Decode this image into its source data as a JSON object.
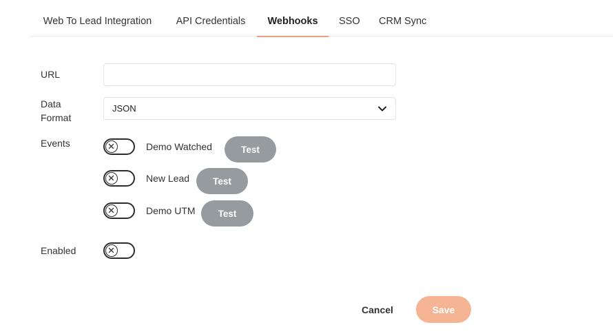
{
  "tabs": [
    {
      "label": "Web To Lead Integration",
      "active": false
    },
    {
      "label": "API Credentials",
      "active": false
    },
    {
      "label": "Webhooks",
      "active": true
    },
    {
      "label": "SSO",
      "active": false
    },
    {
      "label": "CRM Sync",
      "active": false
    }
  ],
  "form": {
    "url_label": "URL",
    "url_value": "",
    "data_format_label_line1": "Data",
    "data_format_label_line2": "Format",
    "data_format_value": "JSON",
    "events_label": "Events",
    "events": [
      {
        "label": "Demo Watched",
        "enabled": false,
        "test_label": "Test"
      },
      {
        "label": "New Lead",
        "enabled": false,
        "test_label": "Test"
      },
      {
        "label": "Demo UTM",
        "enabled": false,
        "test_label": "Test"
      }
    ],
    "enabled_label": "Enabled",
    "enabled_value": false
  },
  "actions": {
    "cancel_label": "Cancel",
    "save_label": "Save"
  },
  "colors": {
    "accent": "#e9a07d",
    "save_button": "#f5b594",
    "test_button": "#969ba0",
    "toggle_border": "#2c2c2c"
  },
  "icons": {
    "select_caret": "chevron-down-icon",
    "toggle_off": "close-icon"
  }
}
